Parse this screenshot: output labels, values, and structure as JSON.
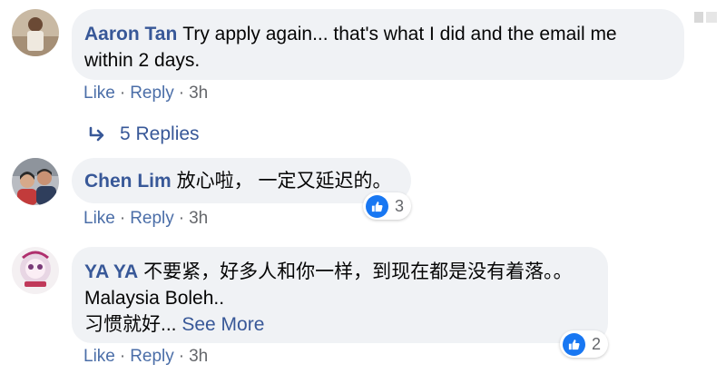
{
  "comments": [
    {
      "author": "Aaron Tan",
      "text_lines": [
        "Try apply again... that's what I did and the email me",
        "within 2 days."
      ],
      "actions": {
        "like": "Like",
        "reply": "Reply",
        "separator": "·",
        "time": "3h"
      },
      "replies_link": "5 Replies"
    },
    {
      "author": "Chen Lim",
      "text_lines": [
        "放心啦， 一定又延迟的。"
      ],
      "actions": {
        "like": "Like",
        "reply": "Reply",
        "separator": "·",
        "time": "3h"
      },
      "reaction_count": "3"
    },
    {
      "author": "YA YA",
      "text_lines": [
        "不要紧，好多人和你一样，到现在都是没有着落。。",
        "Malaysia Boleh..",
        "习惯就好..."
      ],
      "see_more": "See More",
      "actions": {
        "like": "Like",
        "reply": "Reply",
        "separator": "·",
        "time": "3h"
      },
      "reaction_count": "2"
    }
  ],
  "colors": {
    "author": "#385898",
    "bubble": "#f0f2f5",
    "meta": "#65676b",
    "like_blue": "#1877f2"
  },
  "icons": [
    "like-icon",
    "reply-arrow-icon"
  ]
}
